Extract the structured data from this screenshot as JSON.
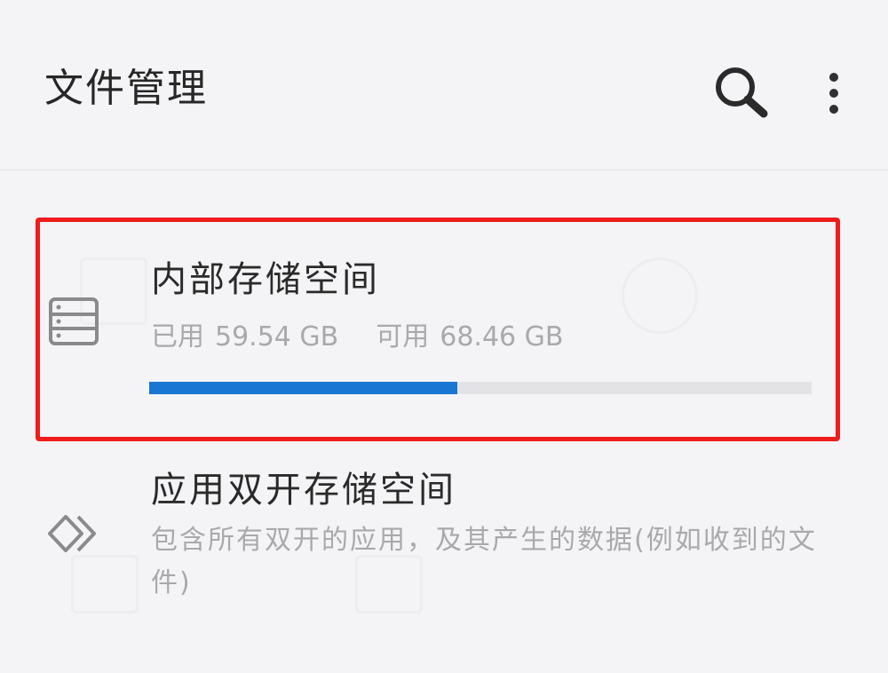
{
  "app_bar": {
    "title": "文件管理",
    "search_icon": "search-icon",
    "more_icon": "more-vertical-icon"
  },
  "internal_storage": {
    "title": "内部存储空间",
    "used_label": "已用",
    "used_value": "59.54 GB",
    "available_label": "可用",
    "available_value": "68.46 GB",
    "used_fraction": 0.465,
    "icon": "storage-list-icon",
    "highlight_color": "#ee1c1c",
    "progress_color": "#1976d2"
  },
  "dual_app_storage": {
    "title": "应用双开存储空间",
    "description": "包含所有双开的应用，及其产生的数据(例如收到的文件)",
    "icon": "dual-diamond-icon"
  }
}
